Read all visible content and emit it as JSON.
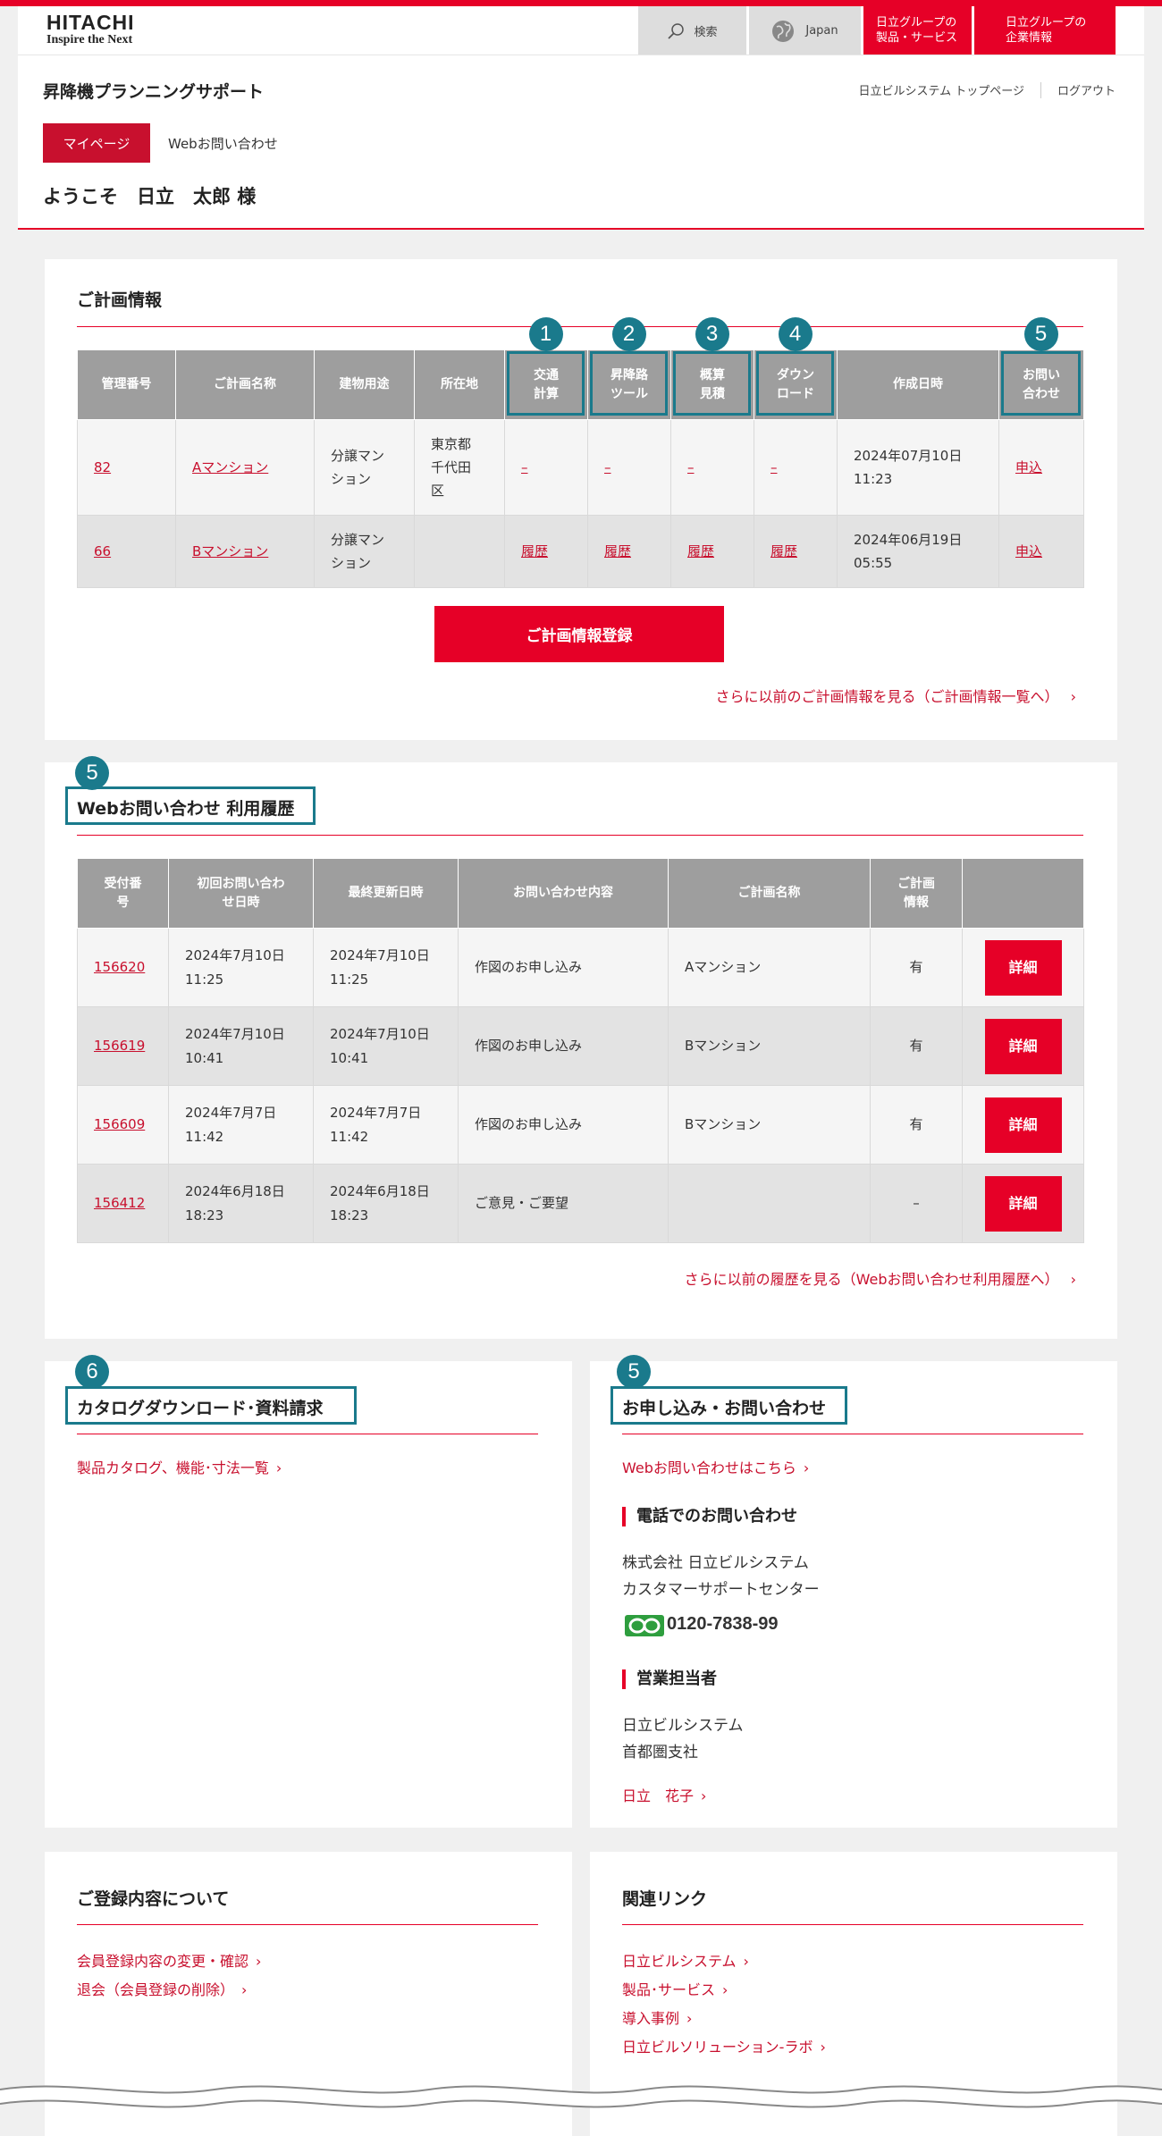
{
  "header": {
    "logo_line1": "HITACHI",
    "logo_line2": "Inspire the Next",
    "search_label": "検索",
    "region_label": "Japan",
    "group_products": [
      "日立グループの",
      "製品・サービス"
    ],
    "group_corporate": [
      "日立グループの",
      "企業情報"
    ],
    "site_title": "昇降機プランニングサポート",
    "top_page_link": "日立ビルシステム トップページ",
    "logout_link": "ログアウト",
    "tabs": [
      "マイページ",
      "Webお問い合わせ"
    ],
    "welcome": "ようこそ　日立　太郎 様"
  },
  "plans": {
    "title": "ご計画情報",
    "columns": [
      "管理番号",
      "ご計画名称",
      "建物用途",
      "所在地",
      "交通計算",
      "昇降路ツール",
      "概算見積",
      "ダウンロード",
      "作成日時",
      "お問い合わせ"
    ],
    "column_display": [
      [
        "管理番号"
      ],
      [
        "ご計画名称"
      ],
      [
        "建物用途"
      ],
      [
        "所在地"
      ],
      [
        "交通",
        "計算"
      ],
      [
        "昇降路",
        "ツール"
      ],
      [
        "概算",
        "見積"
      ],
      [
        "ダウン",
        "ロード"
      ],
      [
        "作成日時"
      ],
      [
        "お問い",
        "合わせ"
      ]
    ],
    "rows": [
      {
        "id": "82",
        "name": "Aマンション",
        "use": [
          "分譲マン",
          "ション"
        ],
        "location": [
          "東京都",
          "千代田",
          "区"
        ],
        "traffic": "–",
        "hoistway": "–",
        "estimate": "–",
        "download": "–",
        "created": [
          "2024年07月10日",
          "11:23"
        ],
        "inquiry": "申込"
      },
      {
        "id": "66",
        "name": "Bマンション",
        "use": [
          "分譲マン",
          "ション"
        ],
        "location": [],
        "traffic": "履歴",
        "hoistway": "履歴",
        "estimate": "履歴",
        "download": "履歴",
        "created": [
          "2024年06月19日",
          "05:55"
        ],
        "inquiry": "申込"
      }
    ],
    "badges": [
      "1",
      "2",
      "3",
      "4",
      "5"
    ],
    "register_button": "ご計画情報登録",
    "more_link": "さらに以前のご計画情報を見る（ご計画情報一覧へ）"
  },
  "web_history": {
    "badge": "5",
    "title": "Webお問い合わせ 利用履歴",
    "column_display": [
      [
        "受付番",
        "号"
      ],
      [
        "初回お問い合わ",
        "せ日時"
      ],
      [
        "最終更新日時"
      ],
      [
        "お問い合わせ内容"
      ],
      [
        "ご計画名称"
      ],
      [
        "ご計画",
        "情報"
      ],
      [
        ""
      ]
    ],
    "rows": [
      {
        "id": "156620",
        "first": [
          "2024年7月10日",
          "11:25"
        ],
        "last": [
          "2024年7月10日",
          "11:25"
        ],
        "content": "作図のお申し込み",
        "plan": "Aマンション",
        "info": "有",
        "action": "詳細"
      },
      {
        "id": "156619",
        "first": [
          "2024年7月10日",
          "10:41"
        ],
        "last": [
          "2024年7月10日",
          "10:41"
        ],
        "content": "作図のお申し込み",
        "plan": "Bマンション",
        "info": "有",
        "action": "詳細"
      },
      {
        "id": "156609",
        "first": [
          "2024年7月7日",
          "11:42"
        ],
        "last": [
          "2024年7月7日",
          "11:42"
        ],
        "content": "作図のお申し込み",
        "plan": "Bマンション",
        "info": "有",
        "action": "詳細"
      },
      {
        "id": "156412",
        "first": [
          "2024年6月18日",
          "18:23"
        ],
        "last": [
          "2024年6月18日",
          "18:23"
        ],
        "content": "ご意見・ご要望",
        "plan": "",
        "info": "–",
        "action": "詳細"
      }
    ],
    "more_link": "さらに以前の履歴を見る（Webお問い合わせ利用履歴へ）"
  },
  "catalog": {
    "badge": "6",
    "title": "カタログダウンロード･資料請求",
    "link": "製品カタログ、機能･寸法一覧"
  },
  "contact": {
    "badge": "5",
    "title": "お申し込み・お問い合わせ",
    "web_link": "Webお問い合わせはこちら",
    "phone_heading": "電話でのお問い合わせ",
    "company": "株式会社 日立ビルシステム",
    "center": "カスタマーサポートセンター",
    "tel": "0120-7838-99",
    "sales_heading": "営業担当者",
    "sales_company": "日立ビルシステム",
    "sales_branch": "首都圏支社",
    "sales_person": "日立　花子"
  },
  "registration": {
    "title": "ご登録内容について",
    "links": [
      "会員登録内容の変更・確認",
      "退会（会員登録の削除）"
    ]
  },
  "related": {
    "title": "関連リンク",
    "links": [
      "日立ビルシステム",
      "製品･サービス",
      "導入事例",
      "日立ビルソリューション-ラボ"
    ]
  },
  "colors": {
    "brand_red": "#e60027",
    "link_red": "#c8102e",
    "highlight_teal": "#1a7a8c",
    "table_header": "#9e9e9e"
  }
}
